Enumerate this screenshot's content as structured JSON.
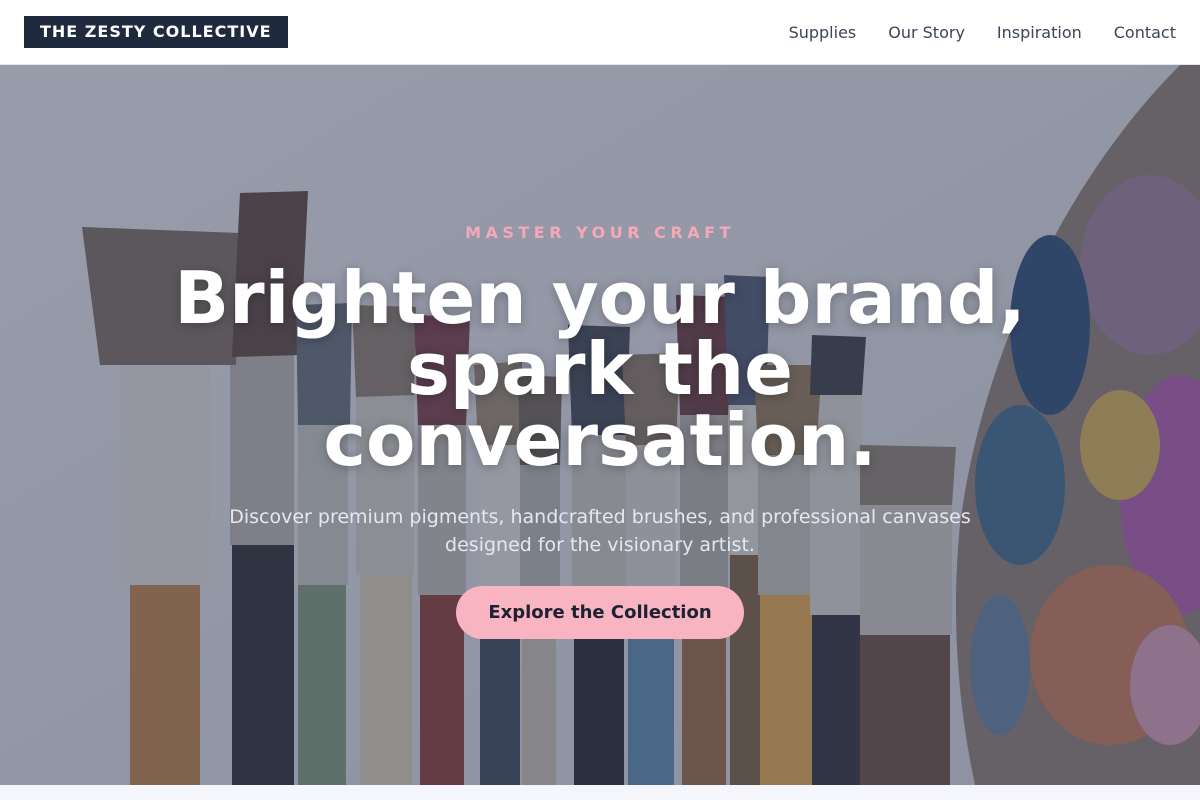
{
  "header": {
    "logo": "THE ZESTY COLLECTIVE",
    "nav": [
      {
        "label": "Supplies"
      },
      {
        "label": "Our Story"
      },
      {
        "label": "Inspiration"
      },
      {
        "label": "Contact"
      }
    ]
  },
  "hero": {
    "eyebrow": "MASTER YOUR CRAFT",
    "headline": "Brighten your brand, spark the conversation.",
    "subtext": "Discover premium pigments, handcrafted brushes, and professional canvases designed for the visionary artist.",
    "cta_label": "Explore the Collection"
  },
  "colors": {
    "brand_dark": "#1f2a3f",
    "accent_pink": "#f8b4c0",
    "eyebrow_pink": "#f7a8b8"
  }
}
